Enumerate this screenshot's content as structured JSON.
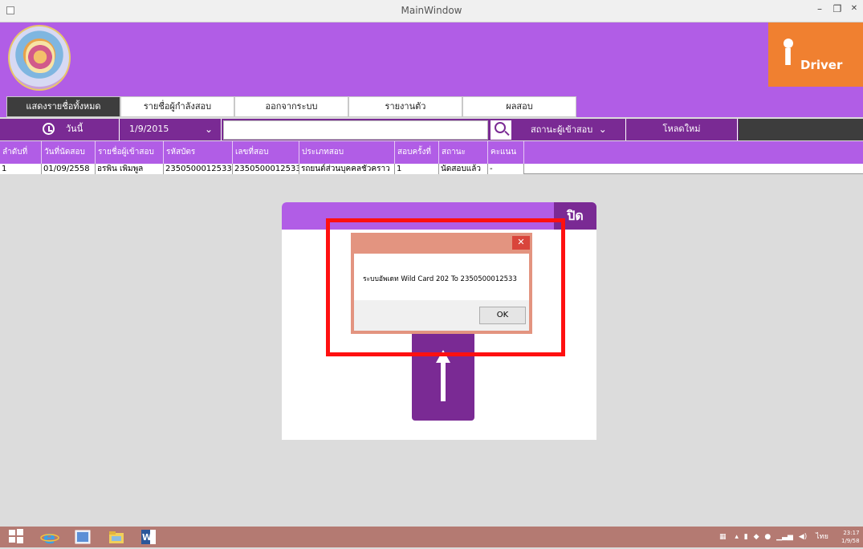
{
  "window": {
    "title": "MainWindow",
    "minimize": "–",
    "maximize": "❐",
    "close": "✕"
  },
  "logo": {
    "brand_i": "i",
    "brand_text": "Driver"
  },
  "menu": {
    "tabs": [
      {
        "label": "แสดงรายชื่อทั้งหมด",
        "active": true
      },
      {
        "label": "รายชื่อผู้กำลังสอบ",
        "active": false
      },
      {
        "label": "ออกจากระบบ",
        "active": false
      },
      {
        "label": "รายงานตัว",
        "active": false
      },
      {
        "label": "ผลสอบ",
        "active": false
      }
    ]
  },
  "filter": {
    "today_label": "วันนี้",
    "date_value": "1/9/2015",
    "search_value": "",
    "status_label": "สถานะผู้เข้าสอบ",
    "reload_label": "โหลดใหม่"
  },
  "table": {
    "headers": [
      "ลำดับที่",
      "วันที่นัดสอบ",
      "รายชื่อผู้เข้าสอบ",
      "รหัสบัตร",
      "เลขที่สอบ",
      "ประเภทสอบ",
      "สอบครั้งที่",
      "สถานะ",
      "คะแนน"
    ],
    "rows": [
      [
        "1",
        "01/09/2558",
        "อรพิน  เพิ่มพูล",
        "2350500012533",
        "2350500012533",
        "รถยนต์ส่วนบุคคลชั่วคราว",
        "1",
        "นัดสอบแล้ว",
        "-"
      ]
    ]
  },
  "panel": {
    "close_label": "ปิด"
  },
  "message_box": {
    "text": "ระบบอัพเดท Wild Card   202   To   2350500012533",
    "ok_label": "OK",
    "close": "✕"
  },
  "taskbar": {
    "language": "ไทย",
    "time": "23:17",
    "date": "1/9/58"
  },
  "colors": {
    "header_purple": "#b15de6",
    "dark_purple": "#7a2a94",
    "logo_orange": "#f08030",
    "highlight_red": "#ff1010",
    "taskbar": "#b47a72"
  }
}
